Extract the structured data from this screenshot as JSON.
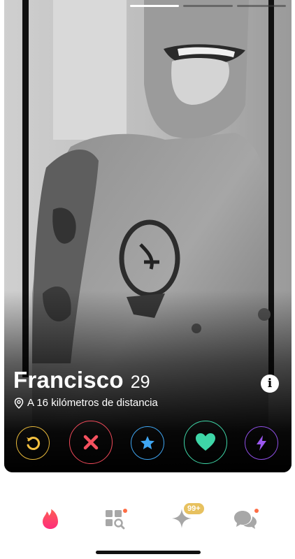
{
  "profile": {
    "name": "Francisco",
    "age": "29",
    "distance": "A 16 kilómetros de distancia",
    "photo_count": 3,
    "active_photo_index": 0
  },
  "card": {
    "info_label": "i"
  },
  "actions": [
    {
      "name": "rewind",
      "icon": "rewind-icon",
      "color": "#e8b93a"
    },
    {
      "name": "nope",
      "icon": "close-icon",
      "color": "#f14a5a"
    },
    {
      "name": "super-like",
      "icon": "star-icon",
      "color": "#3fa6f2"
    },
    {
      "name": "like",
      "icon": "heart-icon",
      "color": "#3ed6a7"
    },
    {
      "name": "boost",
      "icon": "lightning-icon",
      "color": "#8f4fe6"
    }
  ],
  "tabbar": {
    "tabs": [
      {
        "name": "discover",
        "icon": "flame-icon",
        "active": true
      },
      {
        "name": "explore",
        "icon": "explore-grid-icon",
        "notification_dot": true
      },
      {
        "name": "likes-you",
        "icon": "sparkle-icon",
        "badge": "99+"
      },
      {
        "name": "messages",
        "icon": "chat-bubbles-icon",
        "notification_dot": true
      }
    ]
  },
  "colors": {
    "brand_flame": "#fe3c72",
    "badge_gold": "#e7c15f",
    "notification_dot": "#fe6d45"
  }
}
